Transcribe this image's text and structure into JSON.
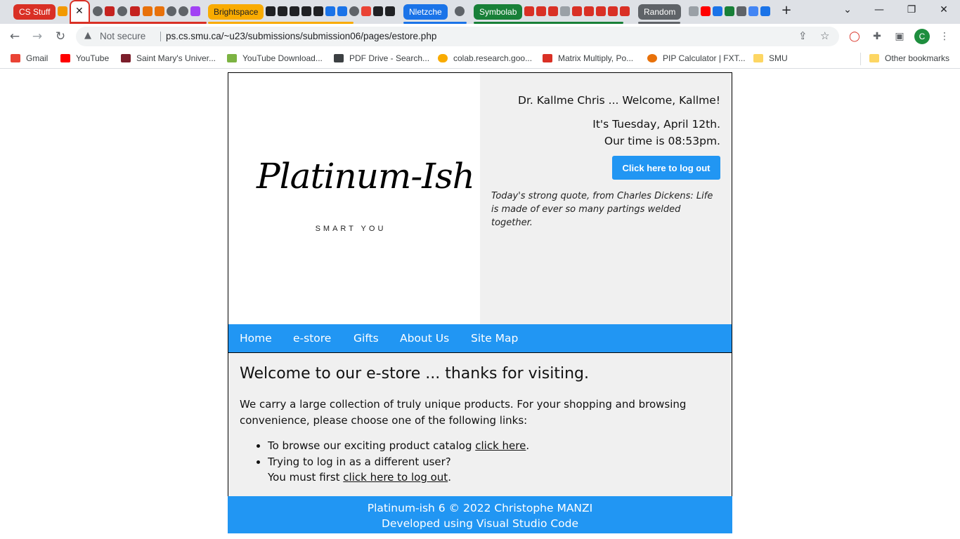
{
  "browser": {
    "tab_groups": [
      {
        "label": "CS Stuff",
        "color": "#d93025"
      },
      {
        "label": "Brightspace",
        "color": "#f9ab00"
      },
      {
        "label": "Nletzche",
        "color": "#1a73e8"
      },
      {
        "label": "Symbolab",
        "color": "#188038"
      },
      {
        "label": "Random",
        "color": "#5f6368"
      }
    ],
    "new_tab": "+",
    "omnibox": {
      "security_label": "Not secure",
      "url": "ps.cs.smu.ca/~u23/submissions/submission06/pages/estore.php"
    },
    "profile_initial": "C",
    "bookmarks": [
      {
        "label": "Gmail"
      },
      {
        "label": "YouTube"
      },
      {
        "label": "Saint Mary's Univer..."
      },
      {
        "label": "YouTube Download..."
      },
      {
        "label": "PDF Drive - Search..."
      },
      {
        "label": "colab.research.goo..."
      },
      {
        "label": "Matrix Multiply, Po..."
      },
      {
        "label": "PIP Calculator | FXT..."
      },
      {
        "label": "SMU"
      }
    ],
    "other_bookmarks": "Other bookmarks"
  },
  "header": {
    "logo_text": "Platinum-Ish",
    "logo_tagline": "SMART YOU",
    "welcome": "Dr. Kallme Chris ... Welcome, Kallme!",
    "date_text": "It's Tuesday, April 12th.",
    "time_text": "Our time is 08:53pm.",
    "logout_label": "Click here to log out",
    "quote": "Today's strong quote, from Charles Dickens: Life is made of ever so many partings welded together."
  },
  "nav": {
    "items": [
      "Home",
      "e-store",
      "Gifts",
      "About Us",
      "Site Map"
    ]
  },
  "content": {
    "title": "Welcome to our e-store ... thanks for visiting.",
    "intro": "We carry a large collection of truly unique products. For your shopping and browsing convenience, please choose one of the following links:",
    "item1_prefix": "To browse our exciting product catalog ",
    "item1_link": "click here",
    "item1_suffix": ".",
    "item2_line1": "Trying to log in as a different user?",
    "item2_prefix": "You must first ",
    "item2_link": "click here to log out",
    "item2_suffix": "."
  },
  "footer": {
    "line1": "Platinum-ish 6 © 2022 Christophe MANZI",
    "line2": "Developed using Visual Studio Code"
  },
  "colors": {
    "accent": "#2196f3",
    "panel": "#f0f0f0"
  }
}
